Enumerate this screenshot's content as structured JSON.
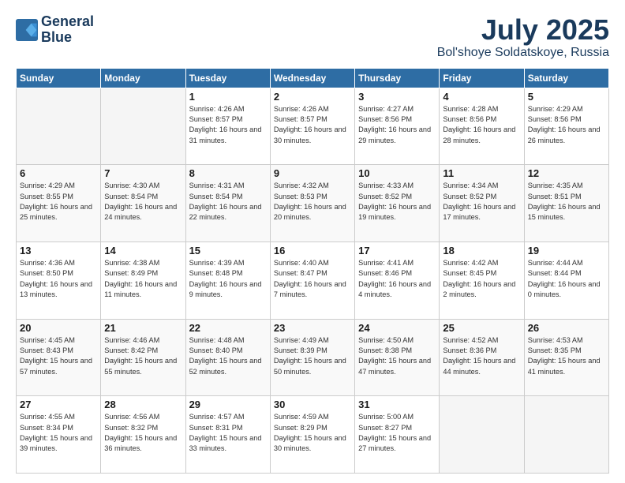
{
  "header": {
    "logo_line1": "General",
    "logo_line2": "Blue",
    "month": "July 2025",
    "location": "Bol'shoye Soldatskoye, Russia"
  },
  "weekdays": [
    "Sunday",
    "Monday",
    "Tuesday",
    "Wednesday",
    "Thursday",
    "Friday",
    "Saturday"
  ],
  "weeks": [
    [
      {
        "day": "",
        "sunrise": "",
        "sunset": "",
        "daylight": ""
      },
      {
        "day": "",
        "sunrise": "",
        "sunset": "",
        "daylight": ""
      },
      {
        "day": "1",
        "sunrise": "Sunrise: 4:26 AM",
        "sunset": "Sunset: 8:57 PM",
        "daylight": "Daylight: 16 hours and 31 minutes."
      },
      {
        "day": "2",
        "sunrise": "Sunrise: 4:26 AM",
        "sunset": "Sunset: 8:57 PM",
        "daylight": "Daylight: 16 hours and 30 minutes."
      },
      {
        "day": "3",
        "sunrise": "Sunrise: 4:27 AM",
        "sunset": "Sunset: 8:56 PM",
        "daylight": "Daylight: 16 hours and 29 minutes."
      },
      {
        "day": "4",
        "sunrise": "Sunrise: 4:28 AM",
        "sunset": "Sunset: 8:56 PM",
        "daylight": "Daylight: 16 hours and 28 minutes."
      },
      {
        "day": "5",
        "sunrise": "Sunrise: 4:29 AM",
        "sunset": "Sunset: 8:56 PM",
        "daylight": "Daylight: 16 hours and 26 minutes."
      }
    ],
    [
      {
        "day": "6",
        "sunrise": "Sunrise: 4:29 AM",
        "sunset": "Sunset: 8:55 PM",
        "daylight": "Daylight: 16 hours and 25 minutes."
      },
      {
        "day": "7",
        "sunrise": "Sunrise: 4:30 AM",
        "sunset": "Sunset: 8:54 PM",
        "daylight": "Daylight: 16 hours and 24 minutes."
      },
      {
        "day": "8",
        "sunrise": "Sunrise: 4:31 AM",
        "sunset": "Sunset: 8:54 PM",
        "daylight": "Daylight: 16 hours and 22 minutes."
      },
      {
        "day": "9",
        "sunrise": "Sunrise: 4:32 AM",
        "sunset": "Sunset: 8:53 PM",
        "daylight": "Daylight: 16 hours and 20 minutes."
      },
      {
        "day": "10",
        "sunrise": "Sunrise: 4:33 AM",
        "sunset": "Sunset: 8:52 PM",
        "daylight": "Daylight: 16 hours and 19 minutes."
      },
      {
        "day": "11",
        "sunrise": "Sunrise: 4:34 AM",
        "sunset": "Sunset: 8:52 PM",
        "daylight": "Daylight: 16 hours and 17 minutes."
      },
      {
        "day": "12",
        "sunrise": "Sunrise: 4:35 AM",
        "sunset": "Sunset: 8:51 PM",
        "daylight": "Daylight: 16 hours and 15 minutes."
      }
    ],
    [
      {
        "day": "13",
        "sunrise": "Sunrise: 4:36 AM",
        "sunset": "Sunset: 8:50 PM",
        "daylight": "Daylight: 16 hours and 13 minutes."
      },
      {
        "day": "14",
        "sunrise": "Sunrise: 4:38 AM",
        "sunset": "Sunset: 8:49 PM",
        "daylight": "Daylight: 16 hours and 11 minutes."
      },
      {
        "day": "15",
        "sunrise": "Sunrise: 4:39 AM",
        "sunset": "Sunset: 8:48 PM",
        "daylight": "Daylight: 16 hours and 9 minutes."
      },
      {
        "day": "16",
        "sunrise": "Sunrise: 4:40 AM",
        "sunset": "Sunset: 8:47 PM",
        "daylight": "Daylight: 16 hours and 7 minutes."
      },
      {
        "day": "17",
        "sunrise": "Sunrise: 4:41 AM",
        "sunset": "Sunset: 8:46 PM",
        "daylight": "Daylight: 16 hours and 4 minutes."
      },
      {
        "day": "18",
        "sunrise": "Sunrise: 4:42 AM",
        "sunset": "Sunset: 8:45 PM",
        "daylight": "Daylight: 16 hours and 2 minutes."
      },
      {
        "day": "19",
        "sunrise": "Sunrise: 4:44 AM",
        "sunset": "Sunset: 8:44 PM",
        "daylight": "Daylight: 16 hours and 0 minutes."
      }
    ],
    [
      {
        "day": "20",
        "sunrise": "Sunrise: 4:45 AM",
        "sunset": "Sunset: 8:43 PM",
        "daylight": "Daylight: 15 hours and 57 minutes."
      },
      {
        "day": "21",
        "sunrise": "Sunrise: 4:46 AM",
        "sunset": "Sunset: 8:42 PM",
        "daylight": "Daylight: 15 hours and 55 minutes."
      },
      {
        "day": "22",
        "sunrise": "Sunrise: 4:48 AM",
        "sunset": "Sunset: 8:40 PM",
        "daylight": "Daylight: 15 hours and 52 minutes."
      },
      {
        "day": "23",
        "sunrise": "Sunrise: 4:49 AM",
        "sunset": "Sunset: 8:39 PM",
        "daylight": "Daylight: 15 hours and 50 minutes."
      },
      {
        "day": "24",
        "sunrise": "Sunrise: 4:50 AM",
        "sunset": "Sunset: 8:38 PM",
        "daylight": "Daylight: 15 hours and 47 minutes."
      },
      {
        "day": "25",
        "sunrise": "Sunrise: 4:52 AM",
        "sunset": "Sunset: 8:36 PM",
        "daylight": "Daylight: 15 hours and 44 minutes."
      },
      {
        "day": "26",
        "sunrise": "Sunrise: 4:53 AM",
        "sunset": "Sunset: 8:35 PM",
        "daylight": "Daylight: 15 hours and 41 minutes."
      }
    ],
    [
      {
        "day": "27",
        "sunrise": "Sunrise: 4:55 AM",
        "sunset": "Sunset: 8:34 PM",
        "daylight": "Daylight: 15 hours and 39 minutes."
      },
      {
        "day": "28",
        "sunrise": "Sunrise: 4:56 AM",
        "sunset": "Sunset: 8:32 PM",
        "daylight": "Daylight: 15 hours and 36 minutes."
      },
      {
        "day": "29",
        "sunrise": "Sunrise: 4:57 AM",
        "sunset": "Sunset: 8:31 PM",
        "daylight": "Daylight: 15 hours and 33 minutes."
      },
      {
        "day": "30",
        "sunrise": "Sunrise: 4:59 AM",
        "sunset": "Sunset: 8:29 PM",
        "daylight": "Daylight: 15 hours and 30 minutes."
      },
      {
        "day": "31",
        "sunrise": "Sunrise: 5:00 AM",
        "sunset": "Sunset: 8:27 PM",
        "daylight": "Daylight: 15 hours and 27 minutes."
      },
      {
        "day": "",
        "sunrise": "",
        "sunset": "",
        "daylight": ""
      },
      {
        "day": "",
        "sunrise": "",
        "sunset": "",
        "daylight": ""
      }
    ]
  ]
}
